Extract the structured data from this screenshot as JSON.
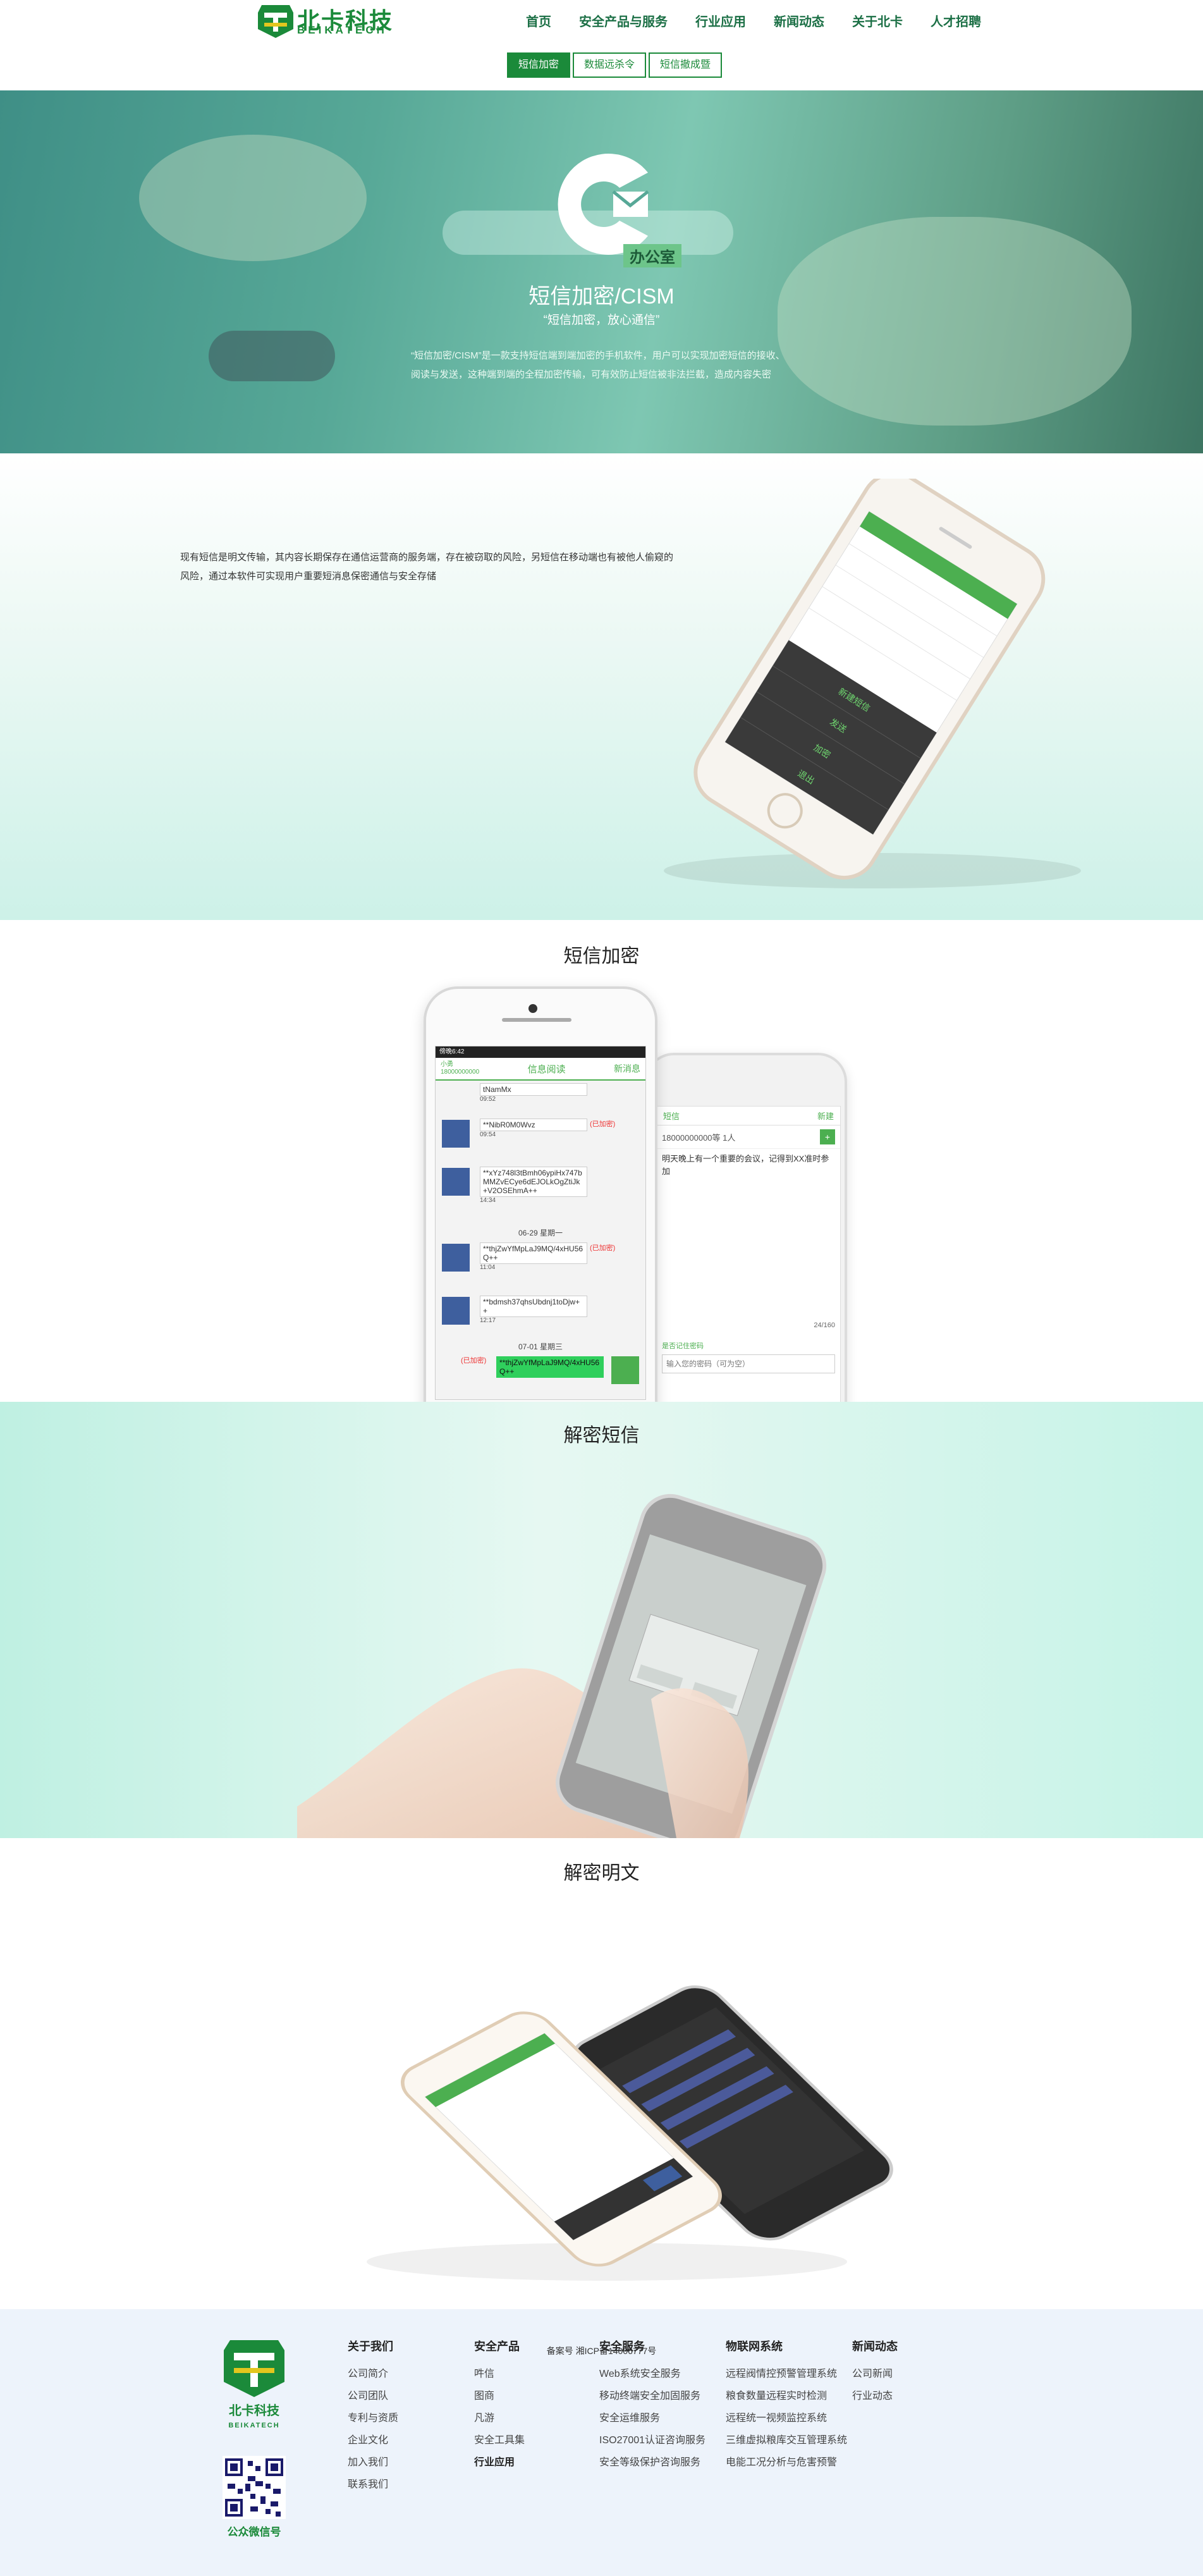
{
  "header": {
    "logo_text": "北卡科技",
    "logo_sub": "BEIKATECH",
    "nav": [
      "首页",
      "安全产品与服务",
      "行业应用",
      "新闻动态",
      "关于北卡",
      "人才招聘"
    ],
    "subtabs": [
      "短信加密",
      "数据远杀令",
      "短信撤成暨"
    ],
    "active_subtab": 0
  },
  "hero": {
    "badge": "办公室",
    "title": "短信加密/CISM",
    "subtitle": "“短信加密，放心通信”",
    "description": "“短信加密/CISM”是一款支持短信端到端加密的手机软件，用户可以实现加密短信的接收、阅读与发送，这种端到端的全程加密传输，可有效防止短信被非法拦截，造成内容失密"
  },
  "intro": {
    "text": "现有短信是明文传输，其内容长期保存在通信运营商的服务端，存在被窃取的风险，另短信在移动端也有被他人偷窥的风险，通过本软件可实现用户重要短消息保密通信与安全存储"
  },
  "phone_menu": [
    "新建短信",
    "发送",
    "加密",
    "退出"
  ],
  "sections": {
    "encrypt_title": "短信加密",
    "decrypt_sms_title": "解密短信",
    "decrypt_plain_title": "解密明文"
  },
  "chat": {
    "status_time": "傍晚6:42",
    "back_label": "小勇",
    "back_number": "18000000000",
    "title": "信息阅读",
    "new_label": "新消息",
    "messages": [
      {
        "text": "tNamMx",
        "time": "09:52"
      },
      {
        "text": "**NibR0M0Wvz",
        "time": "09:54",
        "tag": "(已加密)"
      },
      {
        "text": "**xYz748l3tBmh06ypiHx747bMMZvECye6dEJOLkOgZtiJk+V2OSEhmA++",
        "time": "14:34"
      },
      {
        "text": "**thjZwYfMpLaJ9MQ/4xHU56Q++",
        "time": "11:04",
        "tag": "(已加密)"
      },
      {
        "text": "**bdmsh37qhsUbdnj1toDjw++",
        "time": "12:17"
      }
    ],
    "date1": "06-29 星期一",
    "date2": "07-01 星期三",
    "sent_tag": "(已加密)",
    "sent_text": "**thjZwYfMpLaJ9MQ/4xHU56Q++"
  },
  "compose": {
    "back_label": "短信",
    "send_label": "新建",
    "recipient": "18000000000等 1人",
    "body": "明天晚上有一个重要的会议，记得到XX准时参加",
    "counter": "24/160",
    "remember_label": "是否记住密码",
    "password_placeholder": "输入您的密码（可为空）"
  },
  "footer": {
    "logo_text": "北卡科技",
    "logo_sub": "BEIKATECH",
    "qr_label": "公众微信号",
    "columns": [
      {
        "title": "关于我们",
        "links": [
          "公司简介",
          "公司团队",
          "专利与资质",
          "企业文化",
          "加入我们",
          "联系我们"
        ]
      },
      {
        "title": "安全产品",
        "links": [
          "吽信",
          "图商",
          "凡游",
          "安全工具集"
        ],
        "bold_link": "行业应用"
      },
      {
        "title": "安全服务",
        "links": [
          "Web系统安全服务",
          "移动终端安全加固服务",
          "安全运维服务",
          "ISO27001认证咨询服务",
          "安全等级保护咨询服务"
        ]
      },
      {
        "title": "物联网系统",
        "links": [
          "远程阀情控预警管理系统",
          "粮食数量远程实时检测",
          "远程统一视频监控系统",
          "三维虚拟粮库交互管理系统",
          "电能工况分析与危害预警"
        ]
      },
      {
        "title": "新闻动态",
        "links": [
          "公司新闻",
          "行业动态"
        ]
      }
    ],
    "icp": "备案号   湘ICP备14006777号"
  },
  "colors": {
    "brand_green": "#1b8a3a",
    "hero_teal": "#57a897",
    "footer_bg": "#edf3fb"
  }
}
